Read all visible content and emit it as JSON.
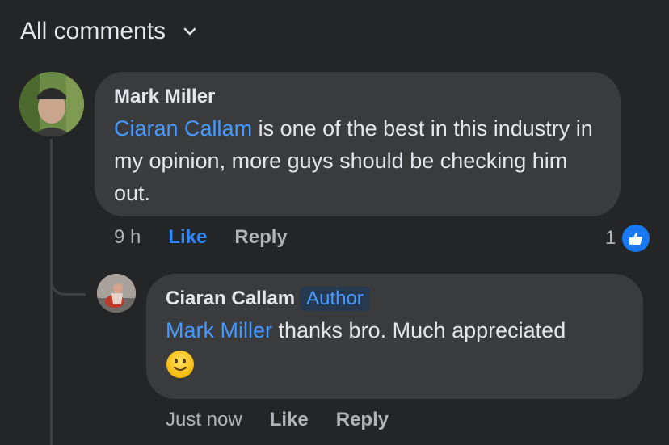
{
  "filter": {
    "label": "All comments"
  },
  "comments": [
    {
      "author": "Mark Miller",
      "mention": "Ciaran Callam",
      "text": " is one of the best in this industry in my opinion, more guys should be checking him out.",
      "time": "9 h",
      "like_label": "Like",
      "reply_label": "Reply",
      "reaction_count": "1"
    },
    {
      "author": "Ciaran Callam",
      "badge": "Author",
      "mention": "Mark Miller",
      "text": " thanks bro. Much appreciated",
      "emoji": "slightly-smiling-face",
      "time": "Just now",
      "like_label": "Like",
      "reply_label": "Reply"
    }
  ],
  "colors": {
    "background": "#242526",
    "bubble": "#3a3b3c",
    "accent": "#2d88ff",
    "mention": "#4599ff"
  }
}
